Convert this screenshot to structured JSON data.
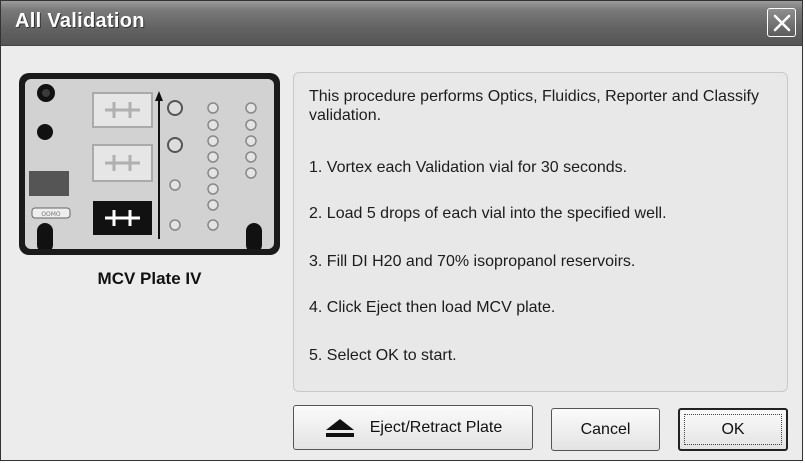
{
  "window": {
    "title": "All Validation"
  },
  "plate": {
    "label": "MCV Plate IV",
    "status_chip": "OOMO"
  },
  "instructions": {
    "intro": "This procedure performs Optics, Fluidics, Reporter and Classify validation.",
    "steps": [
      "1. Vortex each Validation vial for 30 seconds.",
      "2. Load 5 drops of each vial into the specified well.",
      "3. Fill DI H20 and 70% isopropanol reservoirs.",
      "4. Click Eject then load MCV plate.",
      "5. Select OK to start."
    ]
  },
  "buttons": {
    "eject_label": "Eject/Retract Plate",
    "cancel_label": "Cancel",
    "ok_label": "OK"
  },
  "icons": {
    "close": "close-icon",
    "eject": "eject-icon"
  }
}
